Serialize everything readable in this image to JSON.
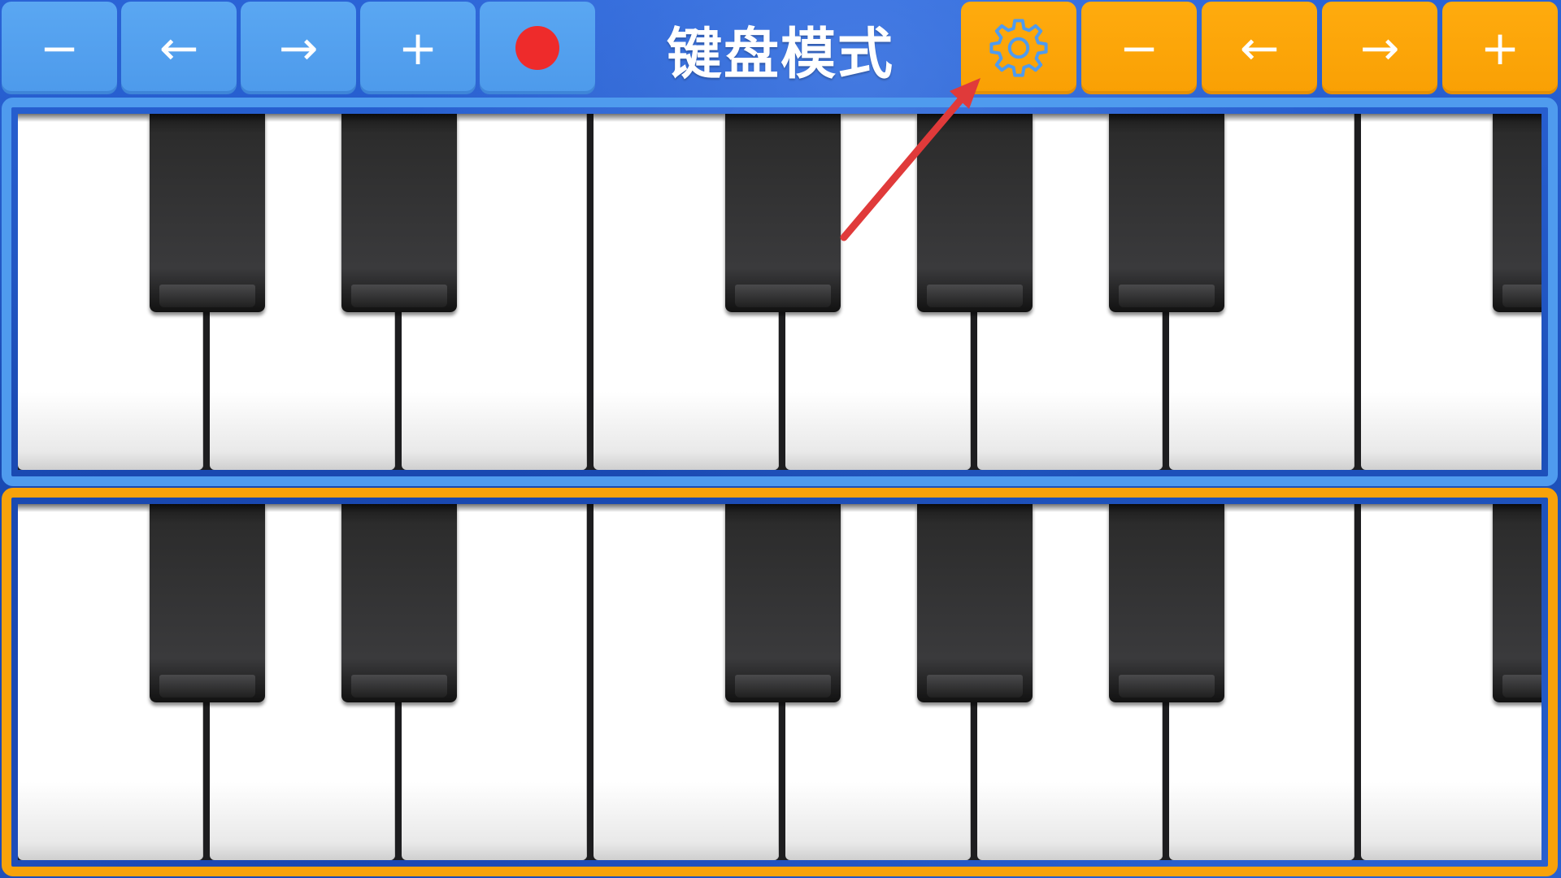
{
  "toolbar": {
    "left_buttons": [
      {
        "name": "zoom-out-button",
        "glyph": "−"
      },
      {
        "name": "shift-left-button",
        "glyph": "←"
      },
      {
        "name": "shift-right-button",
        "glyph": "→"
      },
      {
        "name": "zoom-in-button",
        "glyph": "+"
      }
    ],
    "record_color": "#ee2b2b",
    "title": "键盘模式",
    "right_buttons": [
      {
        "name": "zoom-out-button",
        "glyph": "−"
      },
      {
        "name": "shift-left-button",
        "glyph": "←"
      },
      {
        "name": "shift-right-button",
        "glyph": "→"
      },
      {
        "name": "zoom-in-button",
        "glyph": "+"
      }
    ],
    "settings_icon": "gear-icon"
  },
  "colors": {
    "upper_keyboard_accent": "#4f9bee",
    "lower_keyboard_accent": "#f8a20a",
    "left_buttons": "#5aa7f2",
    "right_buttons": "#ffab0e",
    "annotation_arrow": "#e03a3a"
  },
  "keyboards": [
    {
      "name": "upper-keyboard",
      "white_keys": 8,
      "black_keys": 6
    },
    {
      "name": "lower-keyboard",
      "white_keys": 8,
      "black_keys": 6
    }
  ]
}
